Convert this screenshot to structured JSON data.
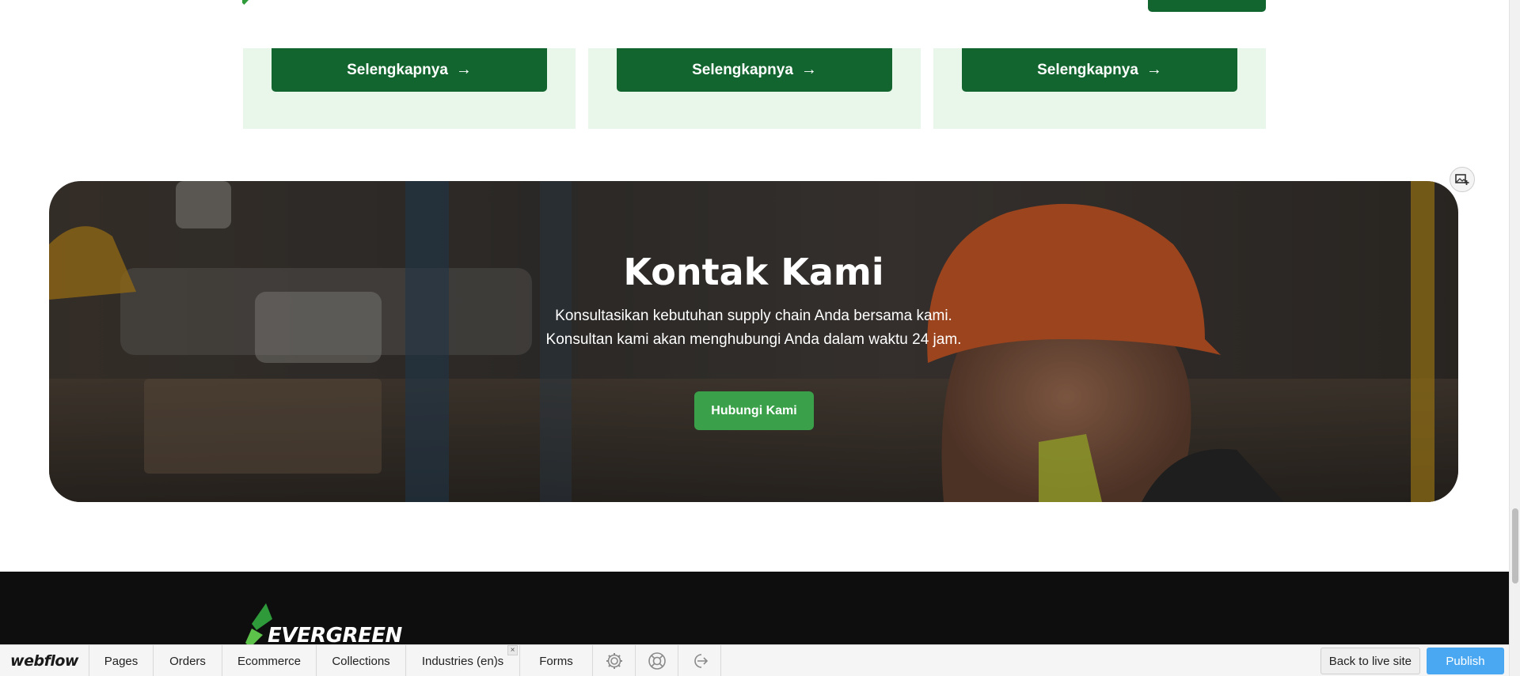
{
  "cards": [
    {
      "button_label": "Selengkapnya"
    },
    {
      "button_label": "Selengkapnya"
    },
    {
      "button_label": "Selengkapnya"
    }
  ],
  "contact": {
    "title": "Kontak Kami",
    "line1": "Konsultasikan kebutuhan supply chain Anda bersama kami.",
    "line2": "Konsultan kami akan menghubungi Anda dalam waktu 24 jam.",
    "button_label": "Hubungi Kami"
  },
  "footer": {
    "logo_text": "EVERGREEN"
  },
  "webflow_bar": {
    "logo": "webflow",
    "items": [
      "Pages",
      "Orders",
      "Ecommerce",
      "Collections",
      "Industries (en)s",
      "Forms"
    ],
    "close_glyph": "×",
    "back_label": "Back to live site",
    "publish_label": "Publish"
  },
  "colors": {
    "primary_green": "#13652f",
    "button_green": "#3aa14a",
    "card_bg": "#e9f7ea",
    "footer_bg": "#0e0e0e",
    "publish_blue": "#4aa8f2"
  },
  "icons": [
    "arrow-right-icon",
    "add-image-icon",
    "settings-gear-icon",
    "help-lifebuoy-icon",
    "share-exit-icon",
    "evergreen-logo-icon"
  ]
}
